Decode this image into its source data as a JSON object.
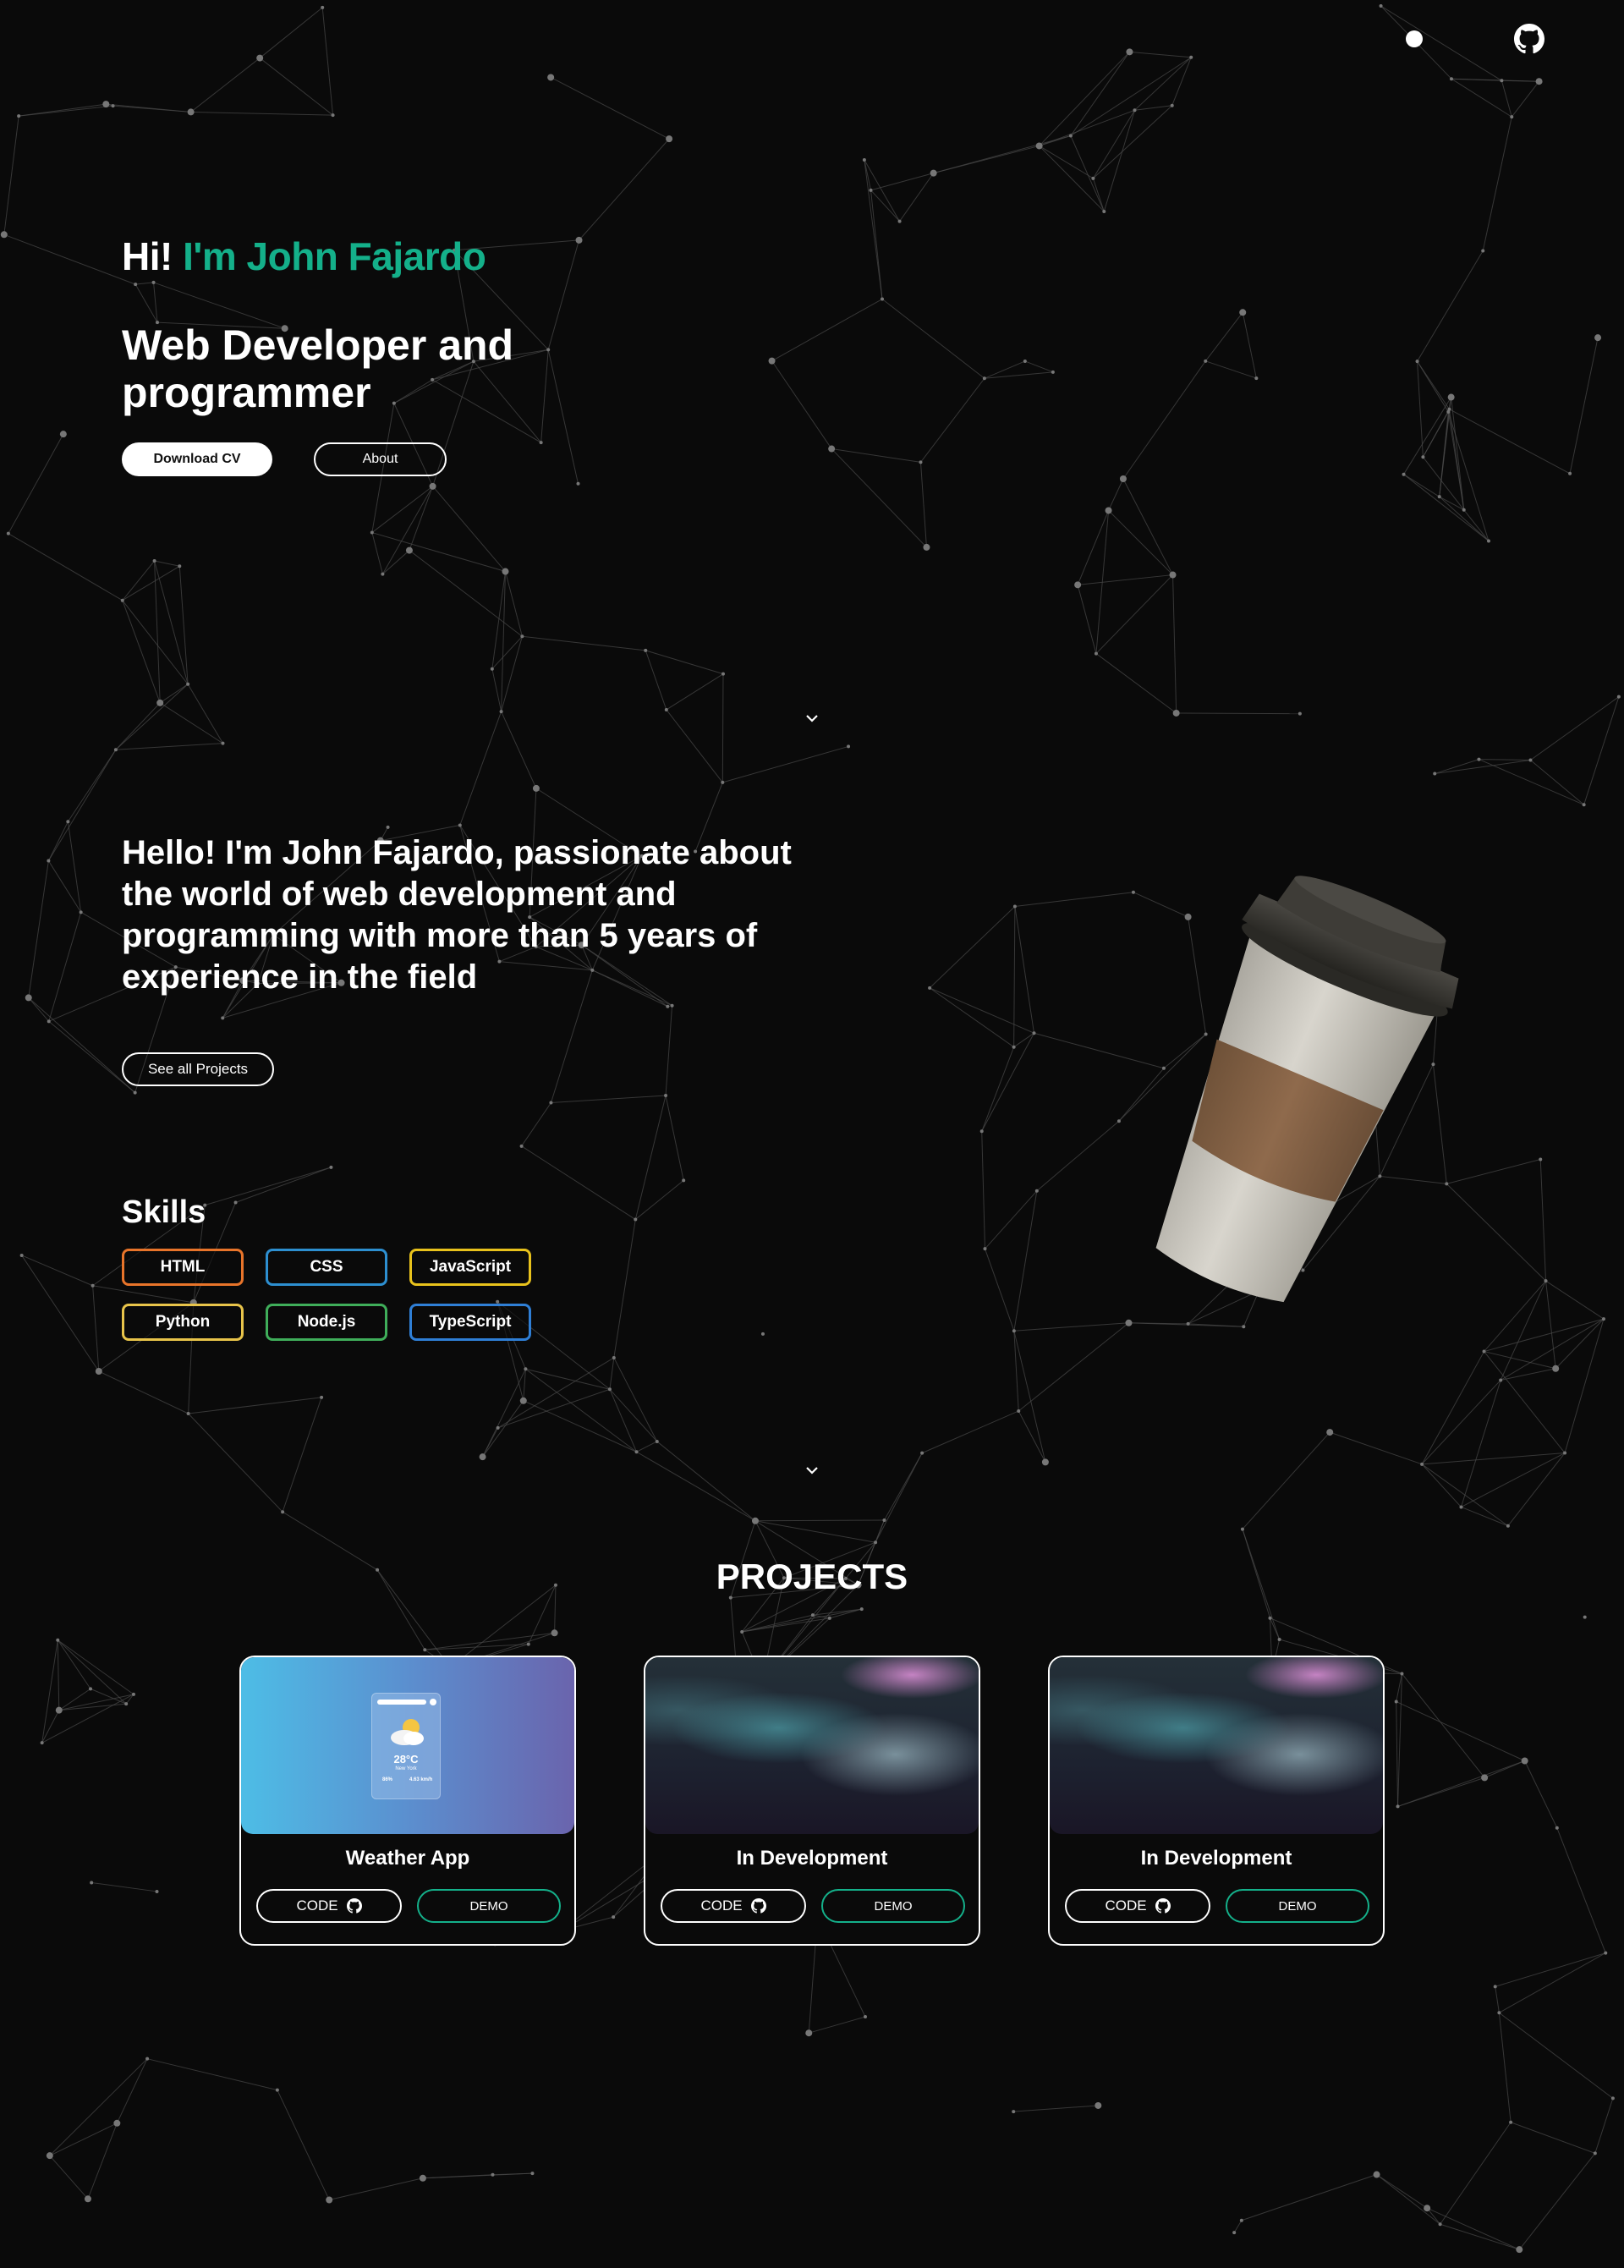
{
  "header": {
    "theme_toggle_icon": "circle-dot-icon",
    "github_icon": "github-icon"
  },
  "hero": {
    "greeting": "Hi!",
    "name": "I'm John Fajardo",
    "subtitle": "Web Developer and programmer",
    "download_cv": "Download CV",
    "about": "About",
    "accent_color": "#14b08a"
  },
  "about": {
    "text": "Hello! I'm John Fajardo, passionate about the world of web development and programming with more than 5 years of experience in the field",
    "see_projects": "See all Projects",
    "image_icon": "coffee-cup-icon"
  },
  "skills": {
    "title": "Skills",
    "items": [
      {
        "label": "HTML",
        "color": "#e8742a"
      },
      {
        "label": "CSS",
        "color": "#2d8fd0"
      },
      {
        "label": "JavaScript",
        "color": "#e8c21c"
      },
      {
        "label": "Python",
        "color": "#e8c44a"
      },
      {
        "label": "Node.js",
        "color": "#3fae5a"
      },
      {
        "label": "TypeScript",
        "color": "#2f7fd6"
      }
    ]
  },
  "projects": {
    "title": "PROJECTS",
    "items": [
      {
        "title": "Weather App",
        "code_label": "CODE",
        "demo_label": "DEMO",
        "preview": {
          "temp": "28°C",
          "city": "New York",
          "humidity": "86%",
          "wind": "4.63 km/h"
        }
      },
      {
        "title": "In Development",
        "code_label": "CODE",
        "demo_label": "DEMO"
      },
      {
        "title": "In Development",
        "code_label": "CODE",
        "demo_label": "DEMO"
      }
    ]
  }
}
